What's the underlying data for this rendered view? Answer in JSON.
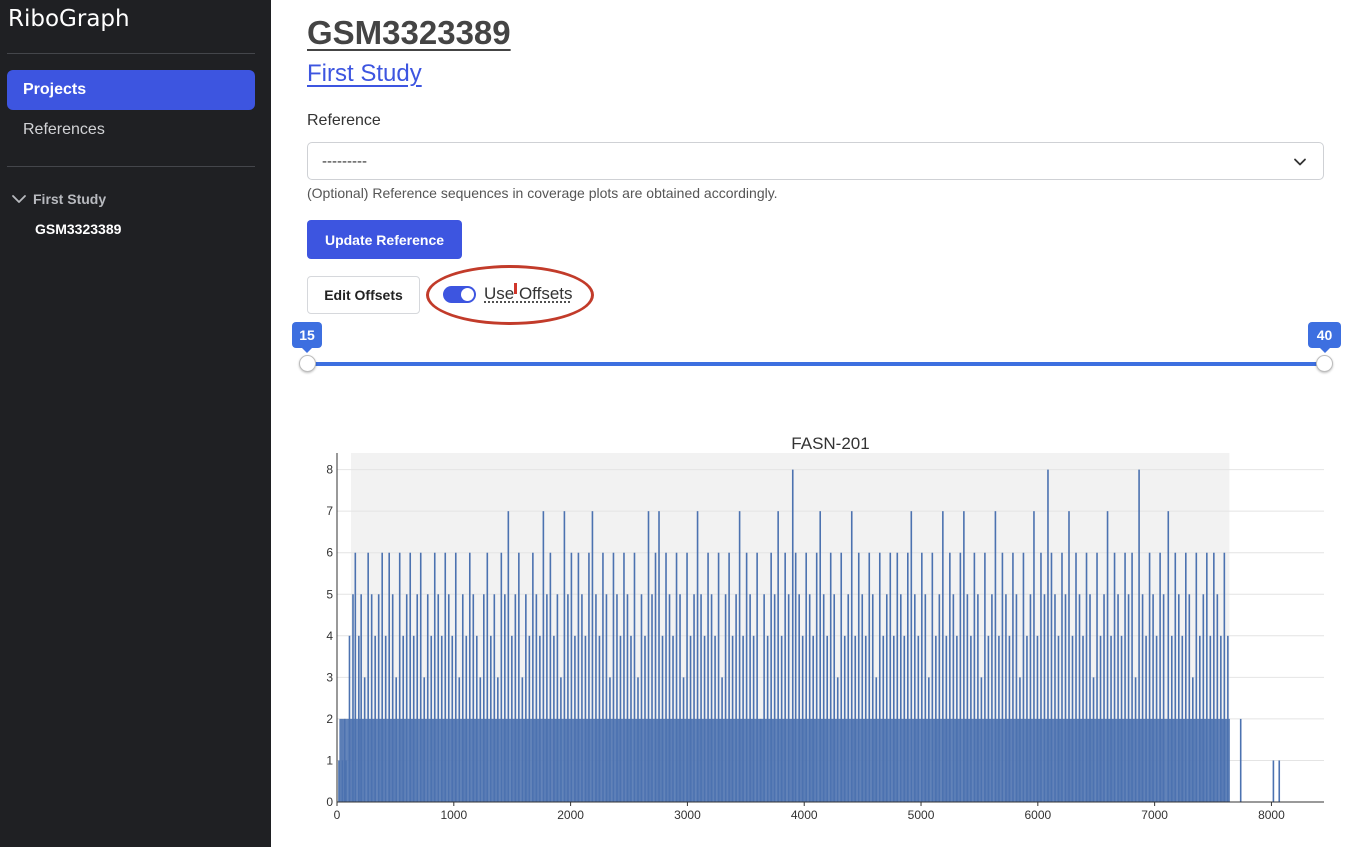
{
  "sidebar": {
    "brand": "RiboGraph",
    "nav": [
      {
        "label": "Projects",
        "active": true
      },
      {
        "label": "References",
        "active": false
      }
    ],
    "tree": {
      "folder": "First Study",
      "leaf": "GSM3323389"
    }
  },
  "main": {
    "sample_title": "GSM3323389",
    "study_link": "First Study",
    "reference": {
      "label": "Reference",
      "selected": "---------",
      "help": "(Optional) Reference sequences in coverage plots are obtained accordingly."
    },
    "update_button": "Update Reference",
    "edit_offsets_button": "Edit Offsets",
    "use_offsets": {
      "label": "Use Offsets",
      "checked": true
    },
    "slider": {
      "min_value": "15",
      "max_value": "40"
    }
  },
  "icons": {
    "nav_chevron": "chevron-down-icon",
    "select_chevron": "chevron-down-icon"
  },
  "colors": {
    "accent": "#3d55e0",
    "sidebar_bg": "#1f2023",
    "bar_color": "#4c72b0",
    "annotation": "#c23b2a"
  },
  "chart_data": {
    "type": "bar",
    "title": "FASN-201",
    "xlabel": "",
    "ylabel": "",
    "xlim": [
      0,
      8450
    ],
    "ylim": [
      0,
      8.4
    ],
    "x_ticks": [
      0,
      1000,
      2000,
      3000,
      4000,
      5000,
      6000,
      7000,
      8000
    ],
    "y_ticks": [
      0,
      1,
      2,
      3,
      4,
      5,
      6,
      7,
      8
    ],
    "cds_region": [
      120,
      7640
    ],
    "grid": true,
    "series": [
      {
        "color": "#4c72b0",
        "points": [
          [
            10,
            1
          ],
          [
            40,
            1
          ],
          [
            60,
            2
          ],
          [
            70,
            1
          ],
          [
            100,
            4
          ],
          [
            130,
            5
          ],
          [
            150,
            6
          ],
          [
            180,
            4
          ],
          [
            200,
            5
          ],
          [
            230,
            3
          ],
          [
            260,
            6
          ],
          [
            290,
            5
          ],
          [
            320,
            4
          ],
          [
            350,
            5
          ],
          [
            380,
            6
          ],
          [
            410,
            4
          ],
          [
            440,
            6
          ],
          [
            470,
            5
          ],
          [
            500,
            3
          ],
          [
            530,
            6
          ],
          [
            560,
            4
          ],
          [
            590,
            5
          ],
          [
            620,
            6
          ],
          [
            650,
            4
          ],
          [
            680,
            5
          ],
          [
            710,
            6
          ],
          [
            740,
            3
          ],
          [
            770,
            5
          ],
          [
            800,
            4
          ],
          [
            830,
            6
          ],
          [
            860,
            5
          ],
          [
            890,
            4
          ],
          [
            920,
            6
          ],
          [
            950,
            5
          ],
          [
            980,
            4
          ],
          [
            1010,
            6
          ],
          [
            1040,
            3
          ],
          [
            1070,
            5
          ],
          [
            1100,
            4
          ],
          [
            1130,
            6
          ],
          [
            1160,
            5
          ],
          [
            1190,
            4
          ],
          [
            1220,
            3
          ],
          [
            1250,
            5
          ],
          [
            1280,
            6
          ],
          [
            1310,
            4
          ],
          [
            1340,
            5
          ],
          [
            1370,
            3
          ],
          [
            1400,
            6
          ],
          [
            1430,
            5
          ],
          [
            1460,
            7
          ],
          [
            1490,
            4
          ],
          [
            1520,
            5
          ],
          [
            1550,
            6
          ],
          [
            1580,
            3
          ],
          [
            1610,
            5
          ],
          [
            1640,
            4
          ],
          [
            1670,
            6
          ],
          [
            1700,
            5
          ],
          [
            1730,
            4
          ],
          [
            1760,
            7
          ],
          [
            1790,
            5
          ],
          [
            1820,
            6
          ],
          [
            1850,
            4
          ],
          [
            1880,
            5
          ],
          [
            1910,
            3
          ],
          [
            1940,
            7
          ],
          [
            1970,
            5
          ],
          [
            2000,
            6
          ],
          [
            2030,
            4
          ],
          [
            2060,
            6
          ],
          [
            2090,
            5
          ],
          [
            2120,
            4
          ],
          [
            2150,
            6
          ],
          [
            2180,
            7
          ],
          [
            2210,
            5
          ],
          [
            2240,
            4
          ],
          [
            2270,
            6
          ],
          [
            2300,
            5
          ],
          [
            2330,
            3
          ],
          [
            2360,
            6
          ],
          [
            2390,
            5
          ],
          [
            2420,
            4
          ],
          [
            2450,
            6
          ],
          [
            2480,
            5
          ],
          [
            2510,
            4
          ],
          [
            2540,
            6
          ],
          [
            2570,
            3
          ],
          [
            2600,
            5
          ],
          [
            2630,
            4
          ],
          [
            2660,
            7
          ],
          [
            2690,
            5
          ],
          [
            2720,
            6
          ],
          [
            2750,
            7
          ],
          [
            2780,
            4
          ],
          [
            2810,
            6
          ],
          [
            2840,
            5
          ],
          [
            2870,
            4
          ],
          [
            2900,
            6
          ],
          [
            2930,
            5
          ],
          [
            2960,
            3
          ],
          [
            2990,
            6
          ],
          [
            3020,
            4
          ],
          [
            3050,
            5
          ],
          [
            3080,
            7
          ],
          [
            3110,
            5
          ],
          [
            3140,
            4
          ],
          [
            3170,
            6
          ],
          [
            3200,
            5
          ],
          [
            3230,
            4
          ],
          [
            3260,
            6
          ],
          [
            3290,
            3
          ],
          [
            3320,
            5
          ],
          [
            3350,
            6
          ],
          [
            3380,
            4
          ],
          [
            3410,
            5
          ],
          [
            3440,
            7
          ],
          [
            3470,
            4
          ],
          [
            3500,
            6
          ],
          [
            3530,
            5
          ],
          [
            3560,
            4
          ],
          [
            3590,
            6
          ],
          [
            3620,
            2
          ],
          [
            3650,
            5
          ],
          [
            3680,
            4
          ],
          [
            3710,
            6
          ],
          [
            3740,
            5
          ],
          [
            3770,
            7
          ],
          [
            3800,
            4
          ],
          [
            3830,
            6
          ],
          [
            3860,
            5
          ],
          [
            3895,
            8
          ],
          [
            3920,
            6
          ],
          [
            3950,
            5
          ],
          [
            3980,
            4
          ],
          [
            4010,
            6
          ],
          [
            4040,
            5
          ],
          [
            4070,
            4
          ],
          [
            4100,
            6
          ],
          [
            4130,
            7
          ],
          [
            4160,
            5
          ],
          [
            4190,
            4
          ],
          [
            4220,
            6
          ],
          [
            4250,
            5
          ],
          [
            4280,
            3
          ],
          [
            4310,
            6
          ],
          [
            4340,
            4
          ],
          [
            4370,
            5
          ],
          [
            4400,
            7
          ],
          [
            4430,
            4
          ],
          [
            4460,
            6
          ],
          [
            4490,
            5
          ],
          [
            4520,
            4
          ],
          [
            4550,
            6
          ],
          [
            4580,
            5
          ],
          [
            4610,
            3
          ],
          [
            4640,
            6
          ],
          [
            4670,
            4
          ],
          [
            4700,
            5
          ],
          [
            4730,
            6
          ],
          [
            4760,
            4
          ],
          [
            4790,
            6
          ],
          [
            4820,
            5
          ],
          [
            4850,
            4
          ],
          [
            4880,
            6
          ],
          [
            4910,
            7
          ],
          [
            4940,
            5
          ],
          [
            4970,
            4
          ],
          [
            5000,
            6
          ],
          [
            5030,
            5
          ],
          [
            5060,
            3
          ],
          [
            5090,
            6
          ],
          [
            5120,
            4
          ],
          [
            5150,
            5
          ],
          [
            5180,
            7
          ],
          [
            5210,
            4
          ],
          [
            5240,
            6
          ],
          [
            5270,
            5
          ],
          [
            5300,
            4
          ],
          [
            5330,
            6
          ],
          [
            5360,
            7
          ],
          [
            5390,
            5
          ],
          [
            5420,
            4
          ],
          [
            5450,
            6
          ],
          [
            5480,
            5
          ],
          [
            5510,
            3
          ],
          [
            5540,
            6
          ],
          [
            5570,
            4
          ],
          [
            5600,
            5
          ],
          [
            5630,
            7
          ],
          [
            5660,
            4
          ],
          [
            5690,
            6
          ],
          [
            5720,
            5
          ],
          [
            5750,
            4
          ],
          [
            5780,
            6
          ],
          [
            5810,
            5
          ],
          [
            5840,
            3
          ],
          [
            5870,
            6
          ],
          [
            5900,
            4
          ],
          [
            5930,
            5
          ],
          [
            5960,
            7
          ],
          [
            5990,
            4
          ],
          [
            6020,
            6
          ],
          [
            6050,
            5
          ],
          [
            6080,
            8
          ],
          [
            6110,
            6
          ],
          [
            6140,
            5
          ],
          [
            6170,
            4
          ],
          [
            6200,
            6
          ],
          [
            6230,
            5
          ],
          [
            6260,
            7
          ],
          [
            6290,
            4
          ],
          [
            6320,
            6
          ],
          [
            6350,
            5
          ],
          [
            6380,
            4
          ],
          [
            6410,
            6
          ],
          [
            6440,
            5
          ],
          [
            6470,
            3
          ],
          [
            6500,
            6
          ],
          [
            6530,
            4
          ],
          [
            6560,
            5
          ],
          [
            6590,
            7
          ],
          [
            6620,
            4
          ],
          [
            6650,
            6
          ],
          [
            6680,
            5
          ],
          [
            6710,
            4
          ],
          [
            6740,
            6
          ],
          [
            6770,
            5
          ],
          [
            6800,
            6
          ],
          [
            6830,
            3
          ],
          [
            6860,
            8
          ],
          [
            6890,
            5
          ],
          [
            6920,
            4
          ],
          [
            6950,
            6
          ],
          [
            6980,
            5
          ],
          [
            7010,
            4
          ],
          [
            7040,
            6
          ],
          [
            7070,
            5
          ],
          [
            7110,
            7
          ],
          [
            7140,
            4
          ],
          [
            7170,
            6
          ],
          [
            7200,
            5
          ],
          [
            7230,
            4
          ],
          [
            7260,
            6
          ],
          [
            7290,
            5
          ],
          [
            7320,
            3
          ],
          [
            7350,
            6
          ],
          [
            7380,
            4
          ],
          [
            7410,
            5
          ],
          [
            7440,
            6
          ],
          [
            7470,
            4
          ],
          [
            7500,
            6
          ],
          [
            7530,
            5
          ],
          [
            7560,
            4
          ],
          [
            7590,
            6
          ],
          [
            7620,
            4
          ],
          [
            7730,
            2
          ],
          [
            8010,
            1
          ],
          [
            8060,
            1
          ]
        ]
      }
    ]
  }
}
